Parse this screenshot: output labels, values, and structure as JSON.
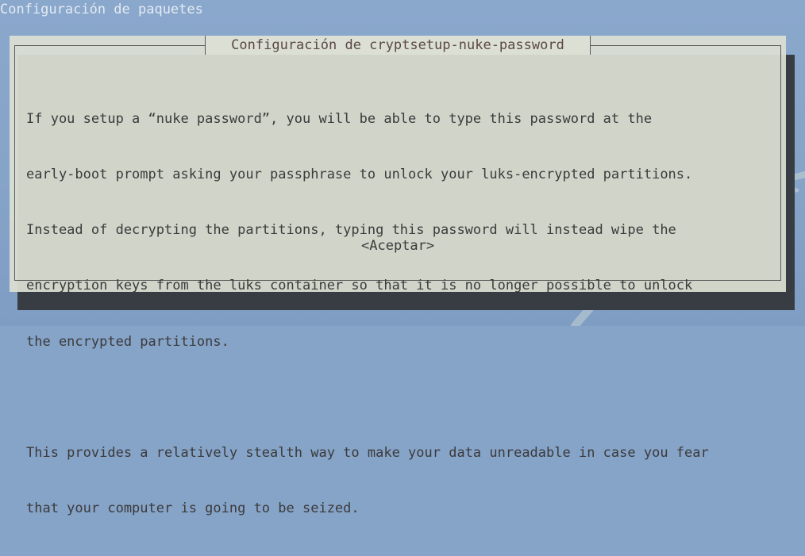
{
  "backtitle": "Configuración de paquetes",
  "dialog": {
    "title": "Configuración de cryptsetup-nuke-password",
    "paragraph1": [
      "If you setup a “nuke password”, you will be able to type this password at the",
      "early-boot prompt asking your passphrase to unlock your luks-encrypted partitions.",
      "Instead of decrypting the partitions, typing this password will instead wipe the",
      "encryption keys from the luks container so that it is no longer possible to unlock",
      "the encrypted partitions."
    ],
    "paragraph2": [
      "This provides a relatively stealth way to make your data unreadable in case you fear",
      "that your computer is going to be seized."
    ],
    "accept_label": "<Aceptar>"
  },
  "colors": {
    "background": "#86a3c8",
    "dialog_bg": "#dce0d4",
    "shadow": "#383d43",
    "text": "#3b3b3b",
    "title_text": "#5a4745"
  },
  "icons": {
    "watermark": "kali-dragon-icon"
  }
}
